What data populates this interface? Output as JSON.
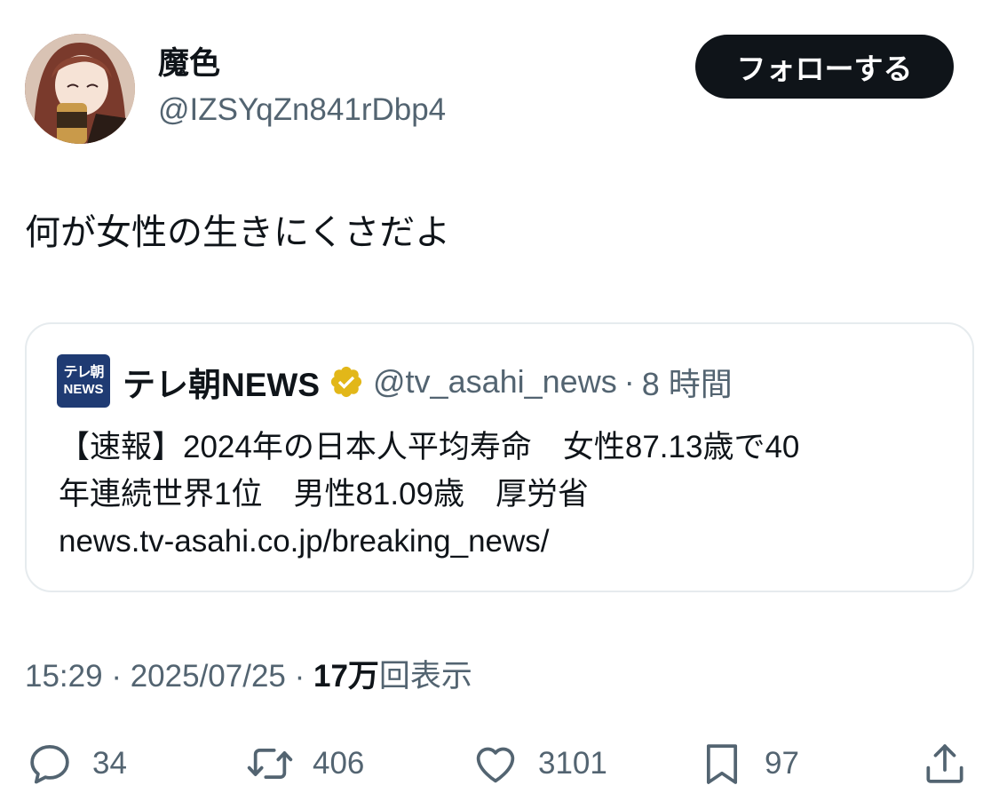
{
  "author": {
    "display_name": "魔色",
    "handle": "@IZSYqZn841rDbp4",
    "avatar_icon": "anime-character-avatar"
  },
  "follow_button": {
    "label": "フォローする"
  },
  "tweet_text": "何が女性の生きにくさだよ",
  "quoted_tweet": {
    "logo_line1": "テレ朝",
    "logo_line2": "NEWS",
    "name": "テレ朝NEWS",
    "verified_icon": "verified-gold-badge-icon",
    "handle": "@tv_asahi_news",
    "separator": "·",
    "time": "8 時間",
    "text_lines": [
      "【速報】2024年の日本人平均寿命　女性87.13歳で40",
      "年連続世界1位　男性81.09歳　厚労省",
      "news.tv-asahi.co.jp/breaking_news/"
    ]
  },
  "meta": {
    "time": "15:29",
    "sep1": " · ",
    "date": "2025/07/25",
    "sep2": " · ",
    "views_count": "17万",
    "views_label": "回表示"
  },
  "actions": {
    "reply": {
      "icon": "reply-icon",
      "count": "34"
    },
    "retweet": {
      "icon": "retweet-icon",
      "count": "406"
    },
    "like": {
      "icon": "heart-icon",
      "count": "3101"
    },
    "bookmark": {
      "icon": "bookmark-icon",
      "count": "97"
    },
    "share": {
      "icon": "share-icon"
    }
  },
  "colors": {
    "text": "#0f1419",
    "secondary": "#536471",
    "border": "#e6ebee",
    "follow_bg": "#0f1419",
    "verified": "#e2b719"
  }
}
